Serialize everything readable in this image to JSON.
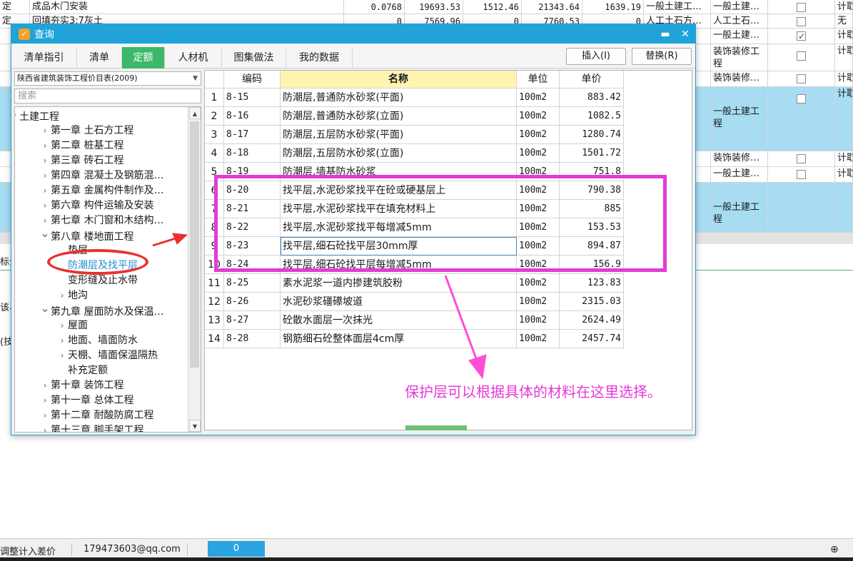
{
  "background": {
    "rows": [
      {
        "c1": "定",
        "c2": "成品木门安装",
        "n1": "0.0768",
        "n2": "19693.53",
        "n3": "1512.46",
        "n4": "21343.64",
        "n5": "1639.19",
        "t1": "一般土建工…",
        "t2": "一般土建…",
        "check": false,
        "last": "计取"
      },
      {
        "c1": "定",
        "c2": "回填夯实3:7灰土",
        "n1": "0",
        "n2": "7569.96",
        "n3": "0",
        "n4": "7760.53",
        "n5": "0",
        "t1": "人工土石方…",
        "t2": "人工土石…",
        "check": false,
        "last": "无"
      },
      {
        "t2": "一般土建…",
        "check": true,
        "last": "计取"
      },
      {
        "t1": "程",
        "t2": "装饰装修工",
        "t2b": "程",
        "check": false,
        "last": "计取"
      },
      {
        "t2": "装饰装修…",
        "check": false,
        "last": "计取"
      },
      {
        "t1": "程",
        "t1b": "十",
        "t2": "一般土建工",
        "t2b": "程",
        "check": false,
        "last": "计取"
      },
      {
        "t2": "装饰装修…",
        "check": false,
        "last": "计取"
      },
      {
        "t2": "一般土建…",
        "check": false,
        "last": "计取"
      },
      {
        "t1": "程",
        "t1b": "十",
        "t2": "一般土建工",
        "t2b": "程"
      }
    ],
    "left_fragments": [
      "标分",
      "该、",
      "(技"
    ]
  },
  "dialog": {
    "title": "查询",
    "minimize_glyph": "▬",
    "close_glyph": "✕",
    "tabs": [
      {
        "label": "清单指引"
      },
      {
        "label": "清单"
      },
      {
        "label": "定额"
      },
      {
        "label": "人材机"
      },
      {
        "label": "图集做法"
      },
      {
        "label": "我的数据"
      }
    ],
    "active_tab": "定额",
    "insert_button": "插入(I)",
    "replace_button": "替换(R)",
    "library": "陕西省建筑装饰工程价目表(2009)",
    "search_placeholder": "搜索"
  },
  "tree": [
    {
      "label": "土建工程",
      "level": 0,
      "toggle": "open"
    },
    {
      "label": "第一章  土石方工程",
      "level": 1,
      "toggle": "closed"
    },
    {
      "label": "第二章  桩基工程",
      "level": 1,
      "toggle": "closed"
    },
    {
      "label": "第三章  砖石工程",
      "level": 1,
      "toggle": "closed"
    },
    {
      "label": "第四章  混凝土及钢筋混…",
      "level": 1,
      "toggle": "closed"
    },
    {
      "label": "第五章  金属构件制作及…",
      "level": 1,
      "toggle": "closed"
    },
    {
      "label": "第六章  构件运输及安装",
      "level": 1,
      "toggle": "closed"
    },
    {
      "label": "第七章  木门窗和木结构…",
      "level": 1,
      "toggle": "closed"
    },
    {
      "label": "第八章  楼地面工程",
      "level": 1,
      "toggle": "open"
    },
    {
      "label": "垫层",
      "level": 2,
      "toggle": "none"
    },
    {
      "label": "防潮层及找平层",
      "level": 2,
      "toggle": "none",
      "selected": true
    },
    {
      "label": "变形缝及止水带",
      "level": 2,
      "toggle": "none"
    },
    {
      "label": "地沟",
      "level": 2,
      "toggle": "closed"
    },
    {
      "label": "第九章  屋面防水及保温…",
      "level": 1,
      "toggle": "open"
    },
    {
      "label": "屋面",
      "level": 2,
      "toggle": "closed"
    },
    {
      "label": "地面、墙面防水",
      "level": 2,
      "toggle": "closed"
    },
    {
      "label": "天棚、墙面保温隔热",
      "level": 2,
      "toggle": "closed"
    },
    {
      "label": "补充定额",
      "level": 2,
      "toggle": "none"
    },
    {
      "label": "第十章  装饰工程",
      "level": 1,
      "toggle": "closed"
    },
    {
      "label": "第十一章  总体工程",
      "level": 1,
      "toggle": "closed"
    },
    {
      "label": "第十二章  耐酸防腐工程",
      "level": 1,
      "toggle": "closed"
    },
    {
      "label": "第十三章  脚手架工程",
      "level": 1,
      "toggle": "closed"
    }
  ],
  "grid": {
    "columns": [
      "",
      "编码",
      "名称",
      "单位",
      "单价"
    ],
    "rows": [
      {
        "idx": "1",
        "code": "8-15",
        "name": "防潮层,普通防水砂浆(平面)",
        "unit": "100m2",
        "price": "883.42"
      },
      {
        "idx": "2",
        "code": "8-16",
        "name": "防潮层,普通防水砂浆(立面)",
        "unit": "100m2",
        "price": "1082.5"
      },
      {
        "idx": "3",
        "code": "8-17",
        "name": "防潮层,五层防水砂浆(平面)",
        "unit": "100m2",
        "price": "1280.74"
      },
      {
        "idx": "4",
        "code": "8-18",
        "name": "防潮层,五层防水砂浆(立面)",
        "unit": "100m2",
        "price": "1501.72"
      },
      {
        "idx": "5",
        "code": "8-19",
        "name": "防潮层,墙基防水砂浆",
        "unit": "100m2",
        "price": "751.8"
      },
      {
        "idx": "6",
        "code": "8-20",
        "name": "找平层,水泥砂浆找平在砼或硬基层上",
        "unit": "100m2",
        "price": "790.38"
      },
      {
        "idx": "7",
        "code": "8-21",
        "name": "找平层,水泥砂浆找平在填充材料上",
        "unit": "100m2",
        "price": "885"
      },
      {
        "idx": "8",
        "code": "8-22",
        "name": "找平层,水泥砂浆找平每增减5mm",
        "unit": "100m2",
        "price": "153.53"
      },
      {
        "idx": "9",
        "code": "8-23",
        "name": "找平层,细石砼找平层30mm厚",
        "unit": "100m2",
        "price": "894.87"
      },
      {
        "idx": "10",
        "code": "8-24",
        "name": "找平层,细石砼找平层每增减5mm",
        "unit": "100m2",
        "price": "156.9"
      },
      {
        "idx": "11",
        "code": "8-25",
        "name": "素水泥浆一道内掺建筑胶粉",
        "unit": "100m2",
        "price": "123.83"
      },
      {
        "idx": "12",
        "code": "8-26",
        "name": "水泥砂浆礓礤坡道",
        "unit": "100m2",
        "price": "2315.03"
      },
      {
        "idx": "13",
        "code": "8-27",
        "name": "砼散水面层一次抹光",
        "unit": "100m2",
        "price": "2624.49"
      },
      {
        "idx": "14",
        "code": "8-28",
        "name": "钢筋细石砼整体面层4cm厚",
        "unit": "100m2",
        "price": "2457.74"
      }
    ]
  },
  "annotation": {
    "text": "保护层可以根据具体的材料在这里选择。",
    "colors": {
      "box": "#e43ad8",
      "ellipse": "#e8312f",
      "arrow": "#e8312f"
    }
  },
  "statusbar": {
    "item1": "调整计入差价",
    "email": "179473603@qq.com",
    "value": "0"
  }
}
